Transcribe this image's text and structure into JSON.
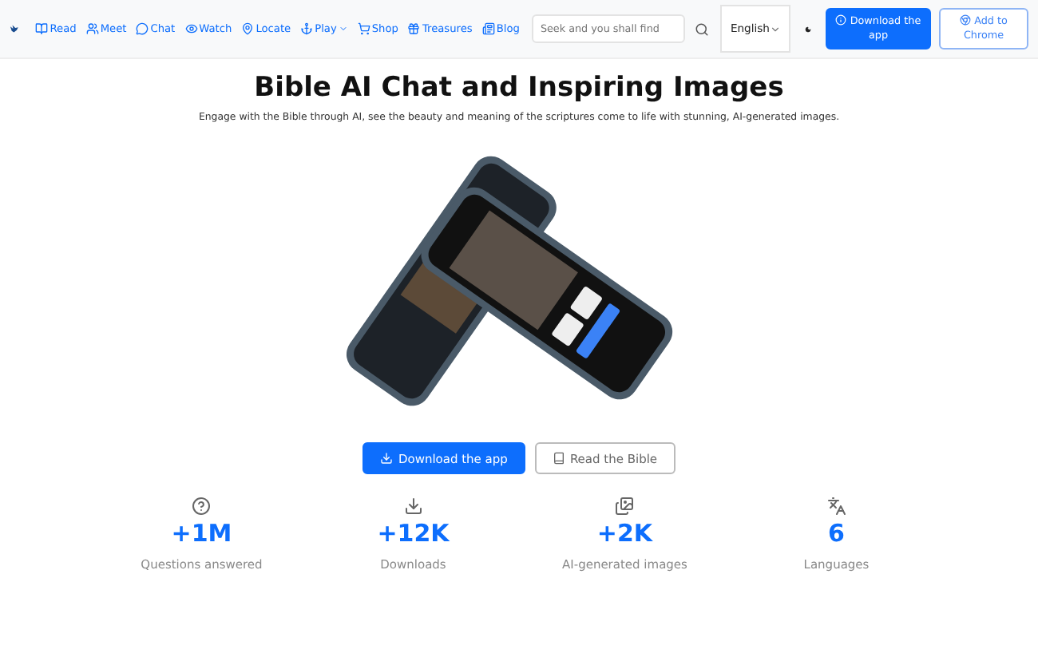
{
  "navbar": {
    "items": [
      {
        "label": "Read",
        "kind": "read"
      },
      {
        "label": "Meet",
        "kind": "meet"
      },
      {
        "label": "Chat",
        "kind": "chat"
      },
      {
        "label": "Watch",
        "kind": "watch"
      },
      {
        "label": "Locate",
        "kind": "locate"
      },
      {
        "label": "Play",
        "kind": "play",
        "dropdown": true
      },
      {
        "label": "Shop",
        "kind": "shop"
      },
      {
        "label": "Treasures",
        "kind": "treasures"
      },
      {
        "label": "Blog",
        "kind": "blog"
      }
    ],
    "search": {
      "placeholder": "Seek and you shall find"
    },
    "language": "English",
    "download_button": "Download the app",
    "chrome_button": "Add to Chrome"
  },
  "hero": {
    "title": "Bible AI Chat and Inspiring Images",
    "subtitle": "Engage with the Bible through AI, see the beauty and meaning of the scriptures come to life with stunning, AI-generated images."
  },
  "actions": [
    {
      "label": "Download the app",
      "kind": "primary"
    },
    {
      "label": "Read the Bible",
      "kind": "outline"
    }
  ],
  "stats": [
    {
      "value": "+1M",
      "label": "Questions answered",
      "kind": "question"
    },
    {
      "value": "+12K",
      "label": "Downloads",
      "kind": "download"
    },
    {
      "value": "+2K",
      "label": "AI-generated images",
      "kind": "images"
    },
    {
      "value": "6",
      "label": "Languages",
      "kind": "languages"
    }
  ]
}
